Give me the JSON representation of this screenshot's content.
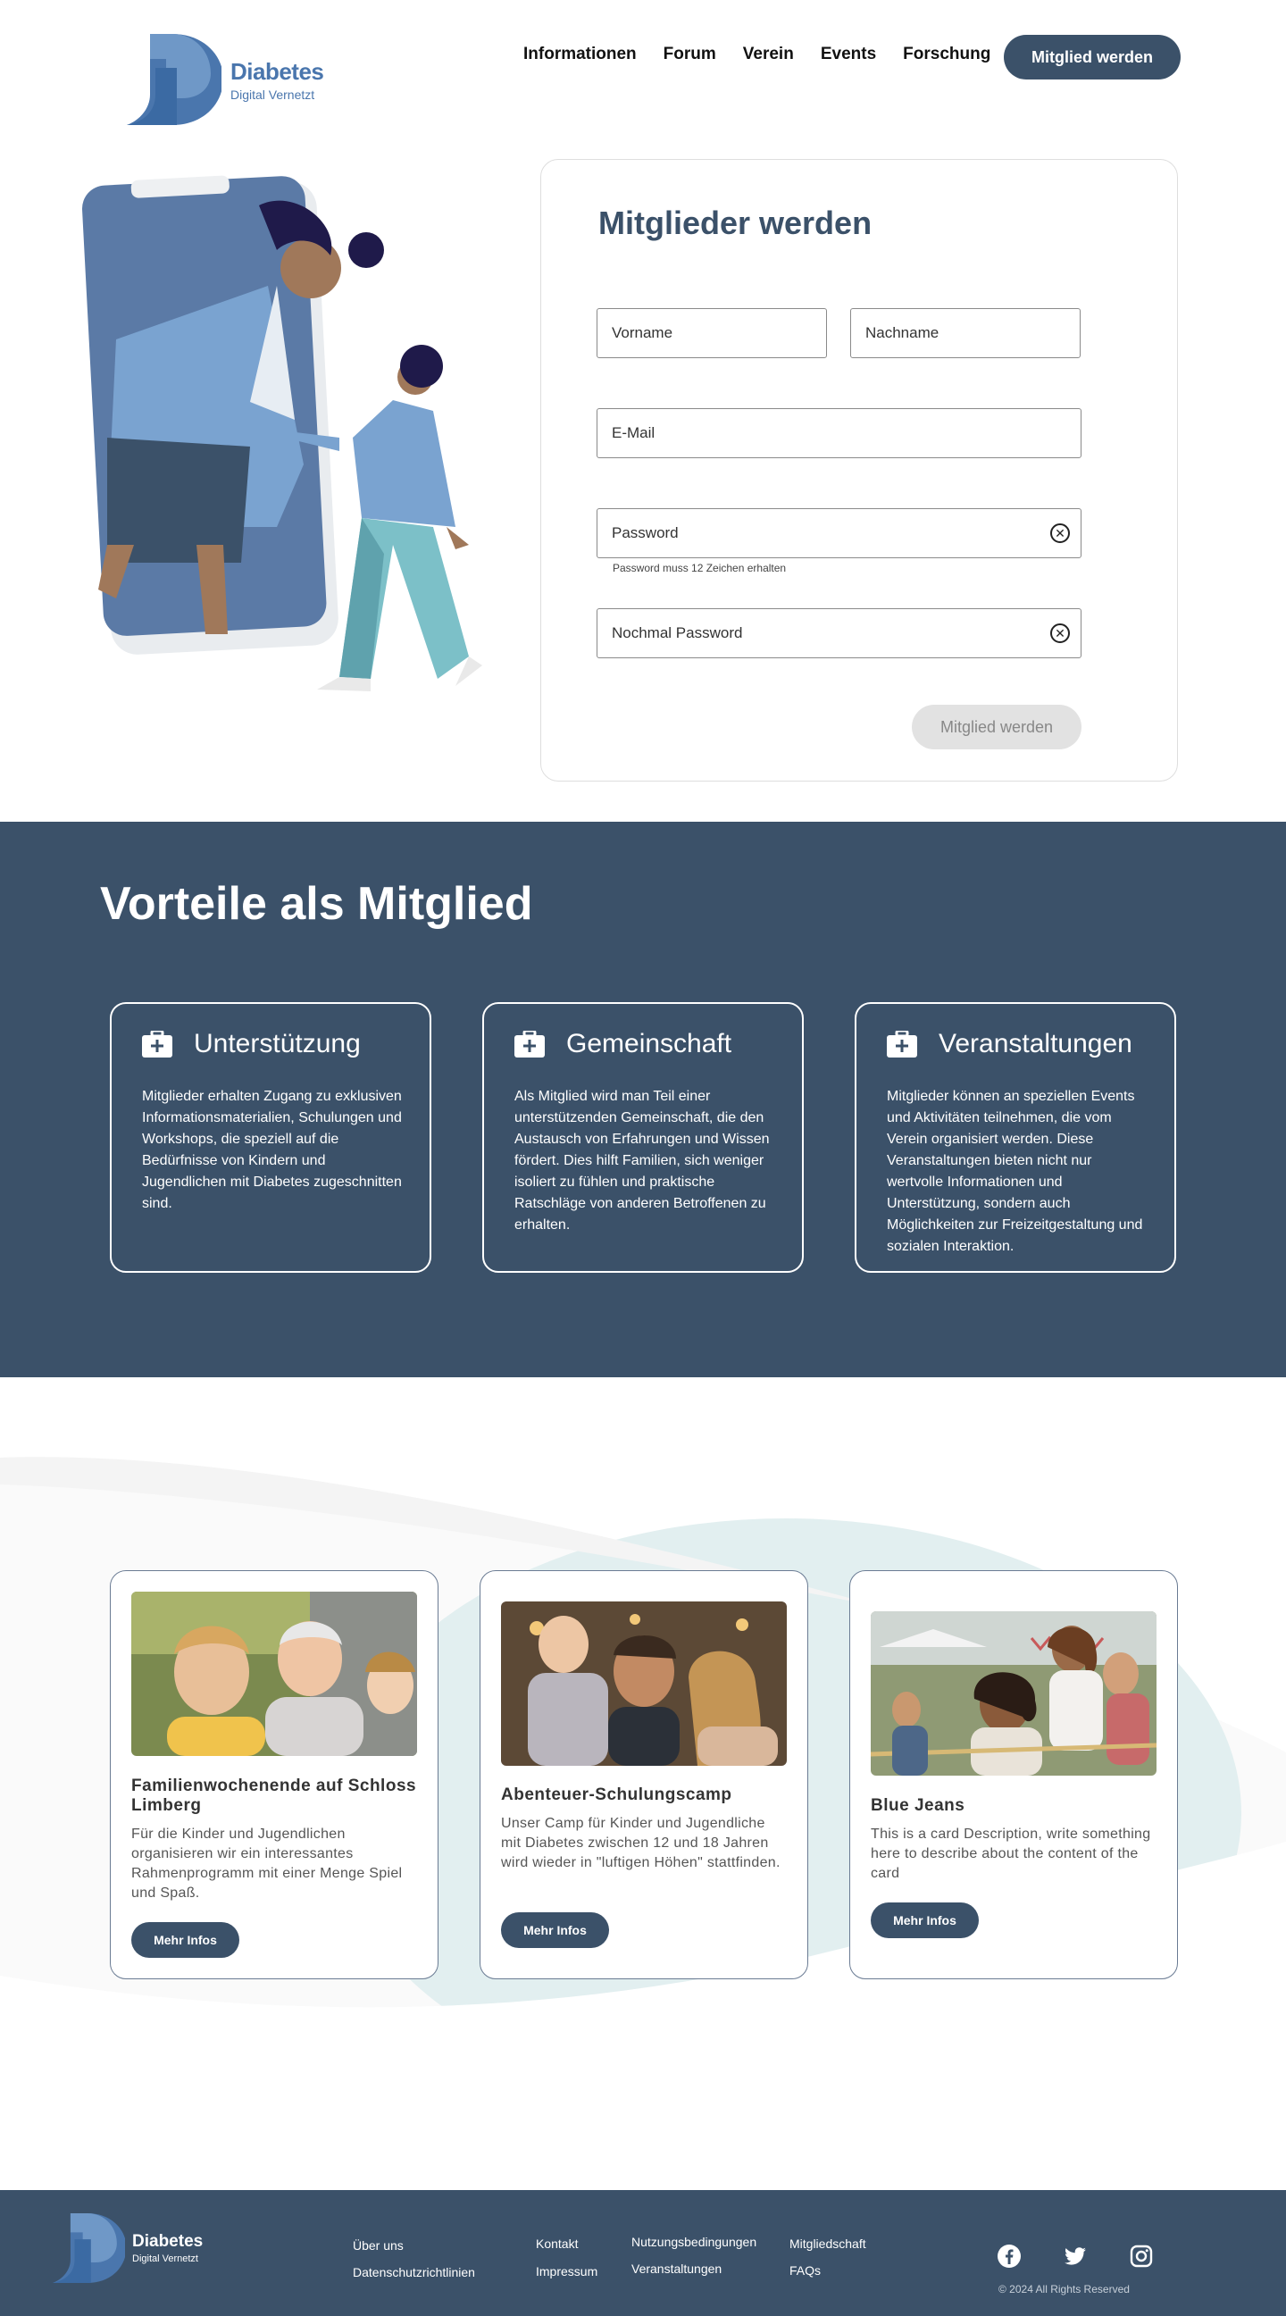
{
  "header": {
    "logo": {
      "title": "Diabetes",
      "subtitle": "Digital Vernetzt"
    },
    "nav": [
      "Informationen",
      "Forum",
      "Verein",
      "Events",
      "Forschung"
    ],
    "cta": "Mitglied werden"
  },
  "form": {
    "title": "Mitglieder werden",
    "firstname_placeholder": "Vorname",
    "lastname_placeholder": "Nachname",
    "email_placeholder": "E-Mail",
    "password_placeholder": "Password",
    "password_hint": "Password muss 12 Zeichen erhalten",
    "password_repeat_placeholder": "Nochmal Password",
    "submit": "Mitglied werden"
  },
  "benefits": {
    "title": "Vorteile als Mitglied",
    "cards": [
      {
        "title": "Unterstützung",
        "text": "Mitglieder erhalten Zugang zu exklusiven Informationsmaterialien, Schulungen und Workshops, die speziell auf die Bedürfnisse von Kindern und Jugendlichen mit Diabetes zugeschnitten sind."
      },
      {
        "title": "Gemeinschaft",
        "text": "Als Mitglied wird man Teil einer unterstützenden Gemeinschaft, die den Austausch von Erfahrungen und Wissen fördert. Dies hilft Familien, sich weniger isoliert zu fühlen und praktische Ratschläge von anderen Betroffenen zu erhalten."
      },
      {
        "title": "Veranstaltungen",
        "text": "Mitglieder können an speziellen Events und Aktivitäten teilnehmen, die vom Verein organisiert werden. Diese Veranstaltungen bieten nicht nur wertvolle Informationen und Unterstützung, sondern auch Möglichkeiten zur Freizeitgestaltung und sozialen Interaktion."
      }
    ]
  },
  "events": {
    "cards": [
      {
        "title": "Familienwochenende auf Schloss Limberg",
        "text": "Für die Kinder und Jugendlichen organisieren wir ein interessantes Rahmenprogramm mit einer Menge Spiel und Spaß.",
        "button": "Mehr Infos"
      },
      {
        "title": "Abenteuer-Schulungscamp",
        "text": "Unser Camp für Kinder und Jugendliche mit Diabetes zwischen 12 und 18 Jahren wird wieder in \"luftigen Höhen\" stattfinden.",
        "button": "Mehr Infos"
      },
      {
        "title": "Blue Jeans",
        "text": "This is a card Description, write something here to describe  about the content of the card",
        "button": "Mehr Infos"
      }
    ]
  },
  "footer": {
    "logo": {
      "title": "Diabetes",
      "subtitle": "Digital Vernetzt"
    },
    "links": {
      "about": "Über uns",
      "privacy": "Datenschutzrichtlinien",
      "contact": "Kontakt",
      "imprint": "Impressum",
      "terms": "Nutzungsbedingungen",
      "events": "Veranstaltungen",
      "membership": "Mitgliedschaft",
      "faqs": "FAQs"
    },
    "social": [
      "facebook-icon",
      "twitter-icon",
      "instagram-icon"
    ],
    "copyright": "© 2024 All Rights Reserved"
  },
  "colors": {
    "primary": "#3b5169",
    "brand_blue": "#4a76ad",
    "accent_light": "#e2eff0"
  }
}
